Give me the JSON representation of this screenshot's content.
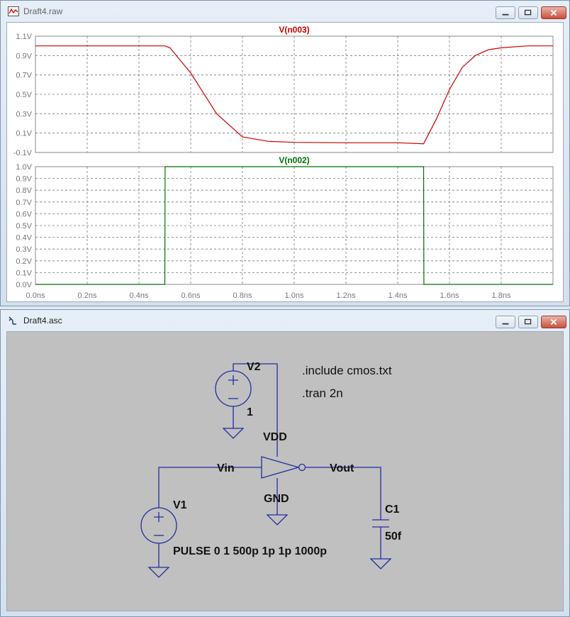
{
  "waveform_window": {
    "title": "Draft4.raw",
    "top_plot": {
      "trace_name": "V(n003)",
      "trace_color": "#cc0000",
      "y_ticks": [
        "1.1V",
        "0.9V",
        "0.7V",
        "0.5V",
        "0.3V",
        "0.1V",
        "-0.1V"
      ]
    },
    "bottom_plot": {
      "trace_name": "V(n002)",
      "trace_color": "#007000",
      "y_ticks": [
        "1.0V",
        "0.9V",
        "0.8V",
        "0.7V",
        "0.6V",
        "0.5V",
        "0.4V",
        "0.3V",
        "0.2V",
        "0.1V",
        "0.0V"
      ]
    },
    "x_ticks": [
      "0.0ns",
      "0.2ns",
      "0.4ns",
      "0.6ns",
      "0.8ns",
      "1.0ns",
      "1.2ns",
      "1.4ns",
      "1.6ns",
      "1.8ns"
    ]
  },
  "schematic_window": {
    "title": "Draft4.asc",
    "directives": [
      ".include cmos.txt",
      ".tran 2n"
    ],
    "components": {
      "v2_name": "V2",
      "v2_value": "1",
      "v1_name": "V1",
      "v1_value": "PULSE 0 1 500p 1p 1p 1000p",
      "c1_name": "C1",
      "c1_value": "50f"
    },
    "net_labels": {
      "vdd": "VDD",
      "gnd": "GND",
      "vin": "Vin",
      "vout": "Vout"
    }
  },
  "chart_data": [
    {
      "type": "line",
      "series": [
        {
          "name": "V(n003)",
          "x": [
            0,
            0.5,
            0.52,
            0.6,
            0.7,
            0.8,
            0.9,
            1.0,
            1.2,
            1.4,
            1.5,
            1.55,
            1.6,
            1.65,
            1.7,
            1.75,
            1.8,
            1.9,
            2.0
          ],
          "y": [
            1.0,
            1.0,
            0.98,
            0.72,
            0.3,
            0.06,
            0.015,
            0.005,
            0.0,
            0.0,
            -0.01,
            0.25,
            0.55,
            0.78,
            0.9,
            0.96,
            0.98,
            1.0,
            1.0
          ]
        }
      ],
      "ylim": [
        -0.1,
        1.1
      ],
      "xlim": [
        0,
        2.0
      ]
    },
    {
      "type": "line",
      "series": [
        {
          "name": "V(n002)",
          "x": [
            0,
            0.5,
            0.501,
            1.5,
            1.501,
            2.0
          ],
          "y": [
            0,
            0,
            1.0,
            1.0,
            0,
            0
          ]
        }
      ],
      "ylim": [
        0,
        1.0
      ],
      "xlim": [
        0,
        2.0
      ]
    }
  ]
}
